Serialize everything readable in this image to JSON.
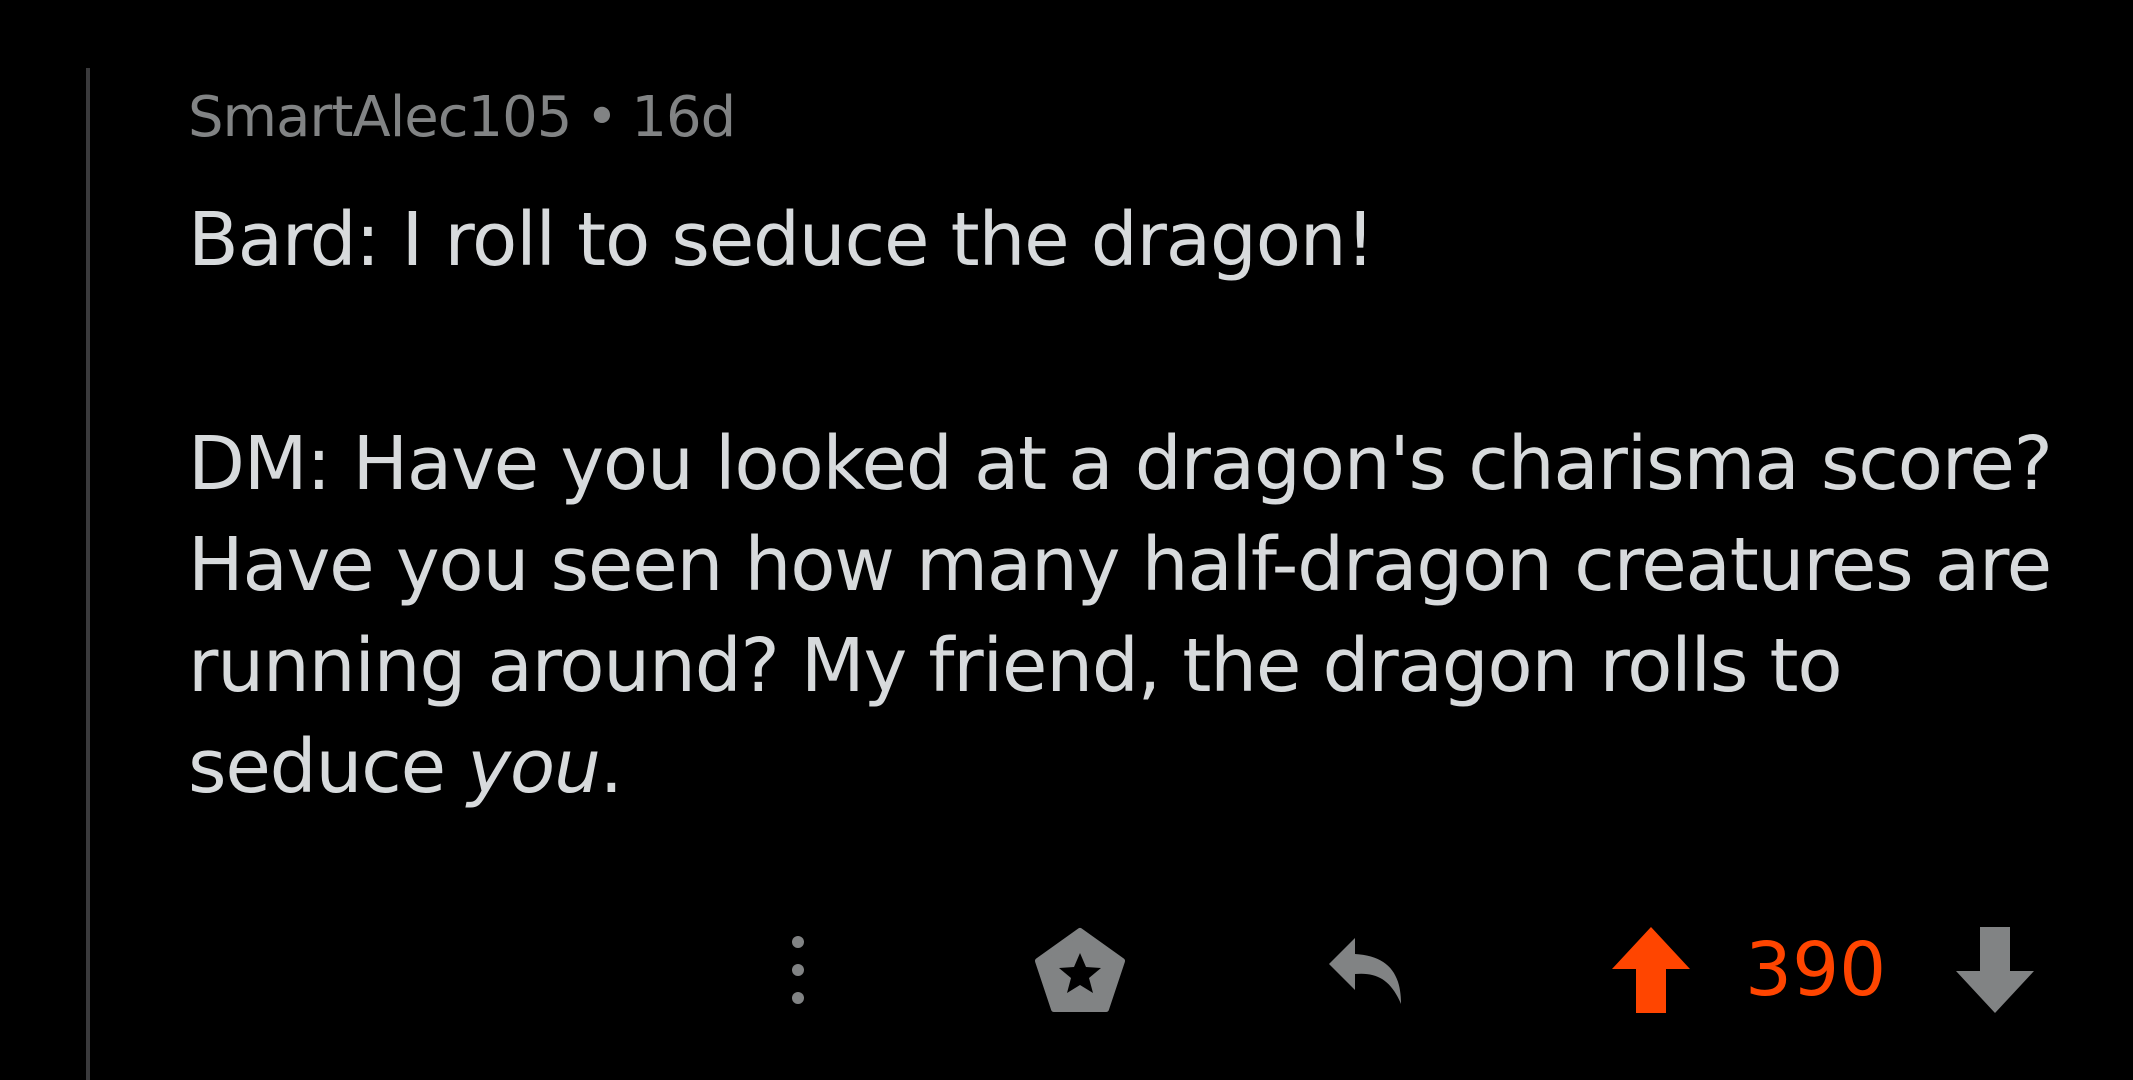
{
  "comment": {
    "author": "SmartAlec105",
    "separator": "•",
    "age": "16d",
    "paragraph1": "Bard: I roll to seduce the dragon!",
    "paragraph2_main": "DM: Have you looked at a dragon's charisma score? Have you seen how many half-dragon creatures are running around? My friend, the dragon rolls to seduce ",
    "paragraph2_italic": "you",
    "paragraph2_end": "."
  },
  "actions": {
    "more_icon": "vertical-ellipsis",
    "award_icon": "award-star",
    "reply_icon": "reply-arrow",
    "upvote_icon": "upvote-arrow",
    "score": "390",
    "downvote_icon": "downvote-arrow"
  },
  "colors": {
    "background": "#000000",
    "meta_text": "#818384",
    "body_text": "#d7dadc",
    "icon": "#818384",
    "upvote_active": "#ff4500"
  }
}
